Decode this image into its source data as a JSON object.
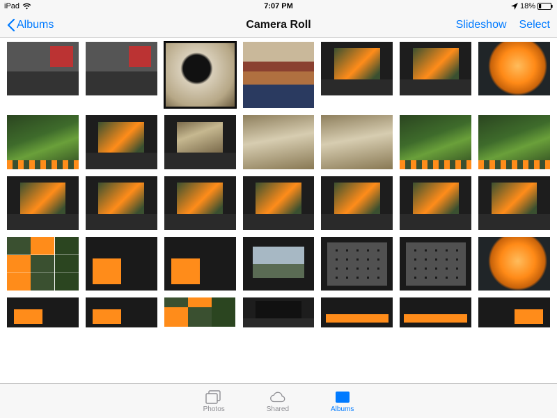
{
  "status": {
    "device": "iPad",
    "time": "7:07 PM",
    "battery_pct": "18%"
  },
  "nav": {
    "back_label": "Albums",
    "title": "Camera Roll",
    "slideshow_label": "Slideshow",
    "select_label": "Select"
  },
  "tabs": {
    "photos": "Photos",
    "shared": "Shared",
    "albums": "Albums",
    "active": "albums"
  },
  "grid": {
    "columns": 7,
    "rows_visible": 5,
    "selected_index": 2,
    "items": [
      {
        "kind": "desk-screenshot"
      },
      {
        "kind": "desk-screenshot"
      },
      {
        "kind": "bw-dog"
      },
      {
        "kind": "family-photo"
      },
      {
        "kind": "editor-poppy"
      },
      {
        "kind": "editor-poppy"
      },
      {
        "kind": "poppy-closeup"
      },
      {
        "kind": "green-editor-strip"
      },
      {
        "kind": "green-editor-panel"
      },
      {
        "kind": "sepia-editor-panel"
      },
      {
        "kind": "sepia-blur"
      },
      {
        "kind": "sepia-blur"
      },
      {
        "kind": "green-editor-strip"
      },
      {
        "kind": "green-editor-strip"
      },
      {
        "kind": "poppy-editor"
      },
      {
        "kind": "poppy-editor"
      },
      {
        "kind": "poppy-editor"
      },
      {
        "kind": "poppy-editor"
      },
      {
        "kind": "poppy-editor"
      },
      {
        "kind": "poppy-side-panel"
      },
      {
        "kind": "poppy-side-panel"
      },
      {
        "kind": "collage-grid"
      },
      {
        "kind": "dark-plus"
      },
      {
        "kind": "dark-list"
      },
      {
        "kind": "mountain-editor"
      },
      {
        "kind": "thumbnails-row"
      },
      {
        "kind": "swatch-grid"
      },
      {
        "kind": "poppy-closeup"
      },
      {
        "kind": "orange-left"
      },
      {
        "kind": "orange-left"
      },
      {
        "kind": "green-grid"
      },
      {
        "kind": "dark-panels"
      },
      {
        "kind": "orange-crop"
      },
      {
        "kind": "orange-crop"
      },
      {
        "kind": "orange-right"
      }
    ]
  }
}
